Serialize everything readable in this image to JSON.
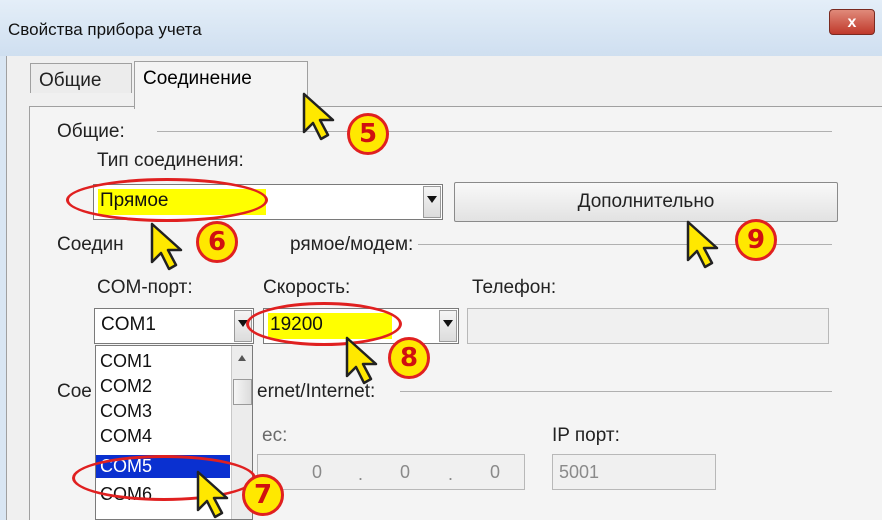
{
  "window": {
    "title": "Свойства прибора учета",
    "close_glyph": "x"
  },
  "tabs": [
    {
      "label": "Общие"
    },
    {
      "label": "Соединение"
    }
  ],
  "general": {
    "group_label": "Общие:",
    "conn_type_label": "Тип соединения:",
    "conn_type_value": "Прямое",
    "extra_button": "Дополнительно"
  },
  "direct": {
    "group_label_prefix": "Соедин",
    "group_label_suffix": "рямое/модем:",
    "com_label": "COM-порт:",
    "com_value": "COM1",
    "speed_label": "Скорость:",
    "speed_value": "19200",
    "phone_label": "Телефон:",
    "phone_value": ""
  },
  "com_list": {
    "items": [
      "COM1",
      "COM2",
      "COM3",
      "COM4",
      "COM5",
      "COM6"
    ],
    "selected": "COM5"
  },
  "internet": {
    "group_label_prefix": "Сое",
    "group_label_suffix": "ernet/Internet:",
    "address_label_suffix": "ес:",
    "ip_parts": [
      "0",
      ".",
      "0",
      ".",
      "0"
    ],
    "port_label": "IP порт:",
    "port_value": "5001"
  },
  "annotations": [
    "5",
    "6",
    "7",
    "8",
    "9"
  ],
  "colors": {
    "highlight": "#ffff00",
    "ring": "#e02020",
    "selection": "#0a30d0"
  }
}
